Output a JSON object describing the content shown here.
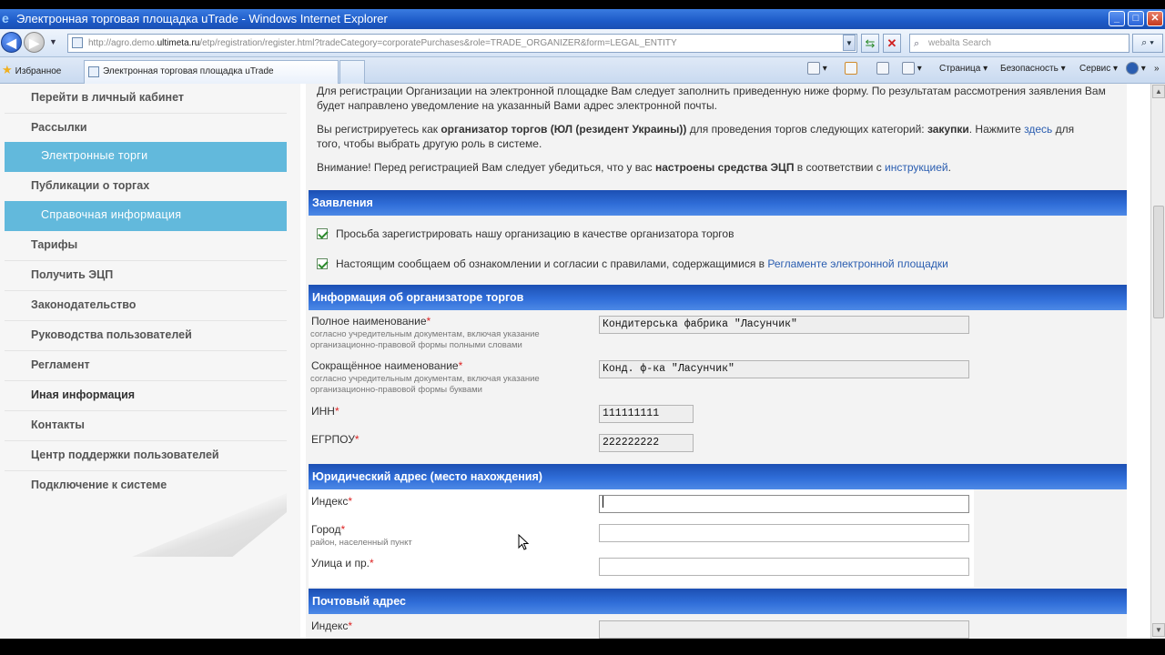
{
  "window": {
    "title": "Электронная торговая площадка uTrade - Windows Internet Explorer",
    "controls": {
      "minimize": "_",
      "maximize": "□",
      "close": "✕"
    }
  },
  "browser": {
    "url_prefix": "http://agro.demo.",
    "url_domain": "ultimeta.ru",
    "url_rest": "/etp/registration/register.html?tradeCategory=corporatePurchases&role=TRADE_ORGANIZER&form=LEGAL_ENTITY",
    "search_placeholder": "webalta Search",
    "favorites_label": "Избранное",
    "tab_title": "Электронная торговая площадка uTrade",
    "toolbar": {
      "page_label": "Страница",
      "security_label": "Безопасность",
      "service_label": "Сервис"
    }
  },
  "sidebar": {
    "items": [
      {
        "label": "Перейти в личный кабинет"
      },
      {
        "label": "Рассылки"
      },
      {
        "label": "Электронные торги"
      },
      {
        "label": "Публикации о торгах"
      },
      {
        "label": "Справочная информация"
      },
      {
        "label": "Тарифы"
      },
      {
        "label": "Получить ЭЦП"
      },
      {
        "label": "Законодательство"
      },
      {
        "label": "Руководства пользователей"
      },
      {
        "label": "Регламент"
      },
      {
        "label": "Иная информация"
      },
      {
        "label": "Контакты"
      },
      {
        "label": "Центр поддержки пользователей"
      },
      {
        "label": "Подключение к системе"
      }
    ]
  },
  "intro": {
    "p1_line1": "Для регистрации Организации на электронной площадке Вам следует заполнить приведенную ниже форму. По результатам рассмотрения заявления Вам",
    "p1_line2": "будет направлено уведомление на указанный Вами адрес электронной почты.",
    "p2_a": "Вы регистрируетесь как ",
    "p2_b": "организатор торгов (ЮЛ (резидент Украины))",
    "p2_c": " для проведения торгов следующих категорий: ",
    "p2_d": "закупки",
    "p2_e": ". Нажмите ",
    "p2_link": "здесь",
    "p2_f": " для",
    "p2_line2": "того, чтобы выбрать другую роль в системе.",
    "p3_a": "Внимание! Перед регистрацией Вам следует убедиться, что у вас ",
    "p3_b": "настроены средства ЭЦП",
    "p3_c": " в соответствии с ",
    "p3_link": "инструкцией",
    "p3_d": "."
  },
  "applications": {
    "header": "Заявления",
    "check1": "Просьба зарегистрировать нашу организацию в качестве организатора торгов",
    "check2_text": "Настоящим сообщаем об ознакомлении и согласии с правилами, содержащимися в ",
    "check2_link": "Регламенте электронной площадки"
  },
  "organizer": {
    "header": "Информация об организаторе торгов",
    "full_name_label": "Полное наименование",
    "full_name_hint1": "согласно учредительным документам, включая указание",
    "full_name_hint2": "организационно-правовой формы полными словами",
    "full_name_value": "Кондитерська фабрика \"Ласунчик\"",
    "short_name_label": "Сокращённое наименование",
    "short_name_hint1": "согласно учредительным документам, включая указание",
    "short_name_hint2": "организационно-правовой формы буквами",
    "short_name_value": "Конд. ф-ка \"Ласунчик\"",
    "inn_label": "ИНН",
    "inn_value": "111111111",
    "egrpou_label": "ЕГРПОУ",
    "egrpou_value": "222222222",
    "required_mark": "*"
  },
  "legal_address": {
    "header": "Юридический адрес (место нахождения)",
    "index_label": "Индекс",
    "city_label": "Город",
    "city_hint": "район, населенный пункт",
    "street_label": "Улица и пр."
  },
  "postal_address": {
    "header": "Почтовый адрес",
    "index_label": "Индекс"
  }
}
